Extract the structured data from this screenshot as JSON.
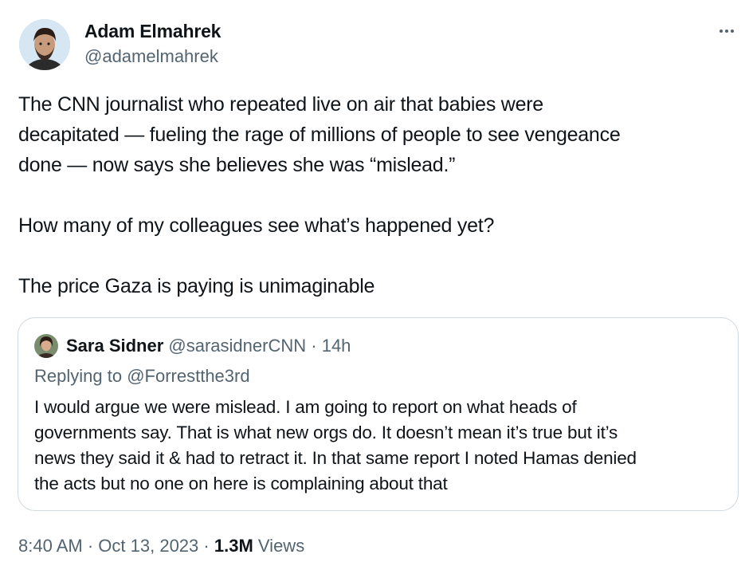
{
  "author": {
    "name": "Adam Elmahrek",
    "handle": "@adamelmahrek"
  },
  "tweet": {
    "paragraphs": [
      [
        "The CNN journalist who repeated live on air that babies were",
        "decapitated — fueling the rage of millions of people to see vengeance",
        "done — now says she believes she was “mislead.”"
      ],
      [
        "How many of my colleagues see what’s happened yet?"
      ],
      [
        "The price Gaza is paying is unimaginable"
      ]
    ]
  },
  "quoted": {
    "name": "Sara Sidner",
    "handle": "@sarasidnerCNN",
    "separator": "·",
    "time": "14h",
    "replying_to_prefix": "Replying to",
    "replying_to_handle": "@Forrestthe3rd",
    "lines": [
      "I would argue we were mislead. I am going to report on what heads of",
      "governments say. That is what new orgs do. It doesn’t mean it’s true but it’s",
      "news they said it & had to retract it. In that same report I noted Hamas denied",
      "the acts but no one on here is complaining about that"
    ]
  },
  "meta": {
    "time": "8:40 AM",
    "separator": "·",
    "date": "Oct 13, 2023",
    "views_count": "1.3M",
    "views_label": "Views"
  },
  "icons": {
    "more": "more-horizontal-icon"
  },
  "colors": {
    "text_primary": "#0f1419",
    "text_secondary": "#536471",
    "border": "#cfd9de"
  }
}
